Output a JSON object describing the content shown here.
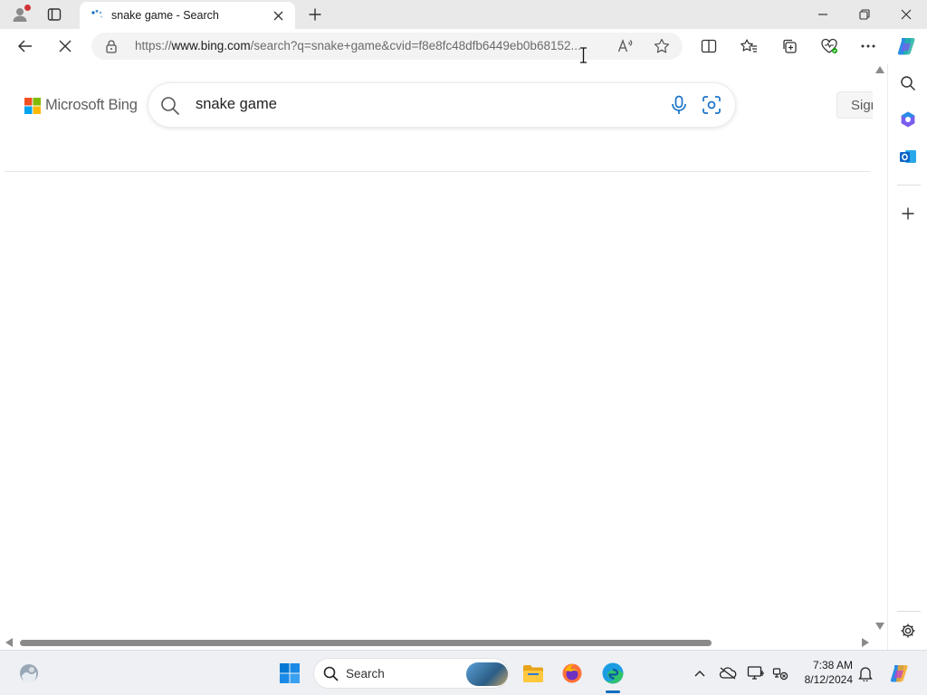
{
  "window": {
    "tab": {
      "title": "snake game - Search"
    }
  },
  "toolbar": {
    "address": {
      "prefix": "https://",
      "host": "www.bing.com",
      "path": "/search?q=snake+game&cvid=f8e8fc48dfb6449eb0b68152..."
    }
  },
  "page": {
    "logo_text": "Microsoft Bing",
    "search_value": "snake game",
    "signin_label": "Sign"
  },
  "taskbar": {
    "search_placeholder": "Search",
    "time": "7:38 AM",
    "date": "8/12/2024"
  },
  "colors": {
    "accent": "#0f6cbd",
    "ms_red": "#f25022",
    "ms_green": "#7fba00",
    "ms_blue": "#00a4ef",
    "ms_yellow": "#ffb900"
  },
  "icons": {
    "tab": [
      "profile-icon",
      "tab-actions-icon",
      "loading-spinner-icon",
      "close-icon",
      "plus-icon",
      "minimize-icon",
      "restore-icon",
      "close-window-icon"
    ],
    "toolbar": [
      "back-arrow-icon",
      "stop-loading-icon",
      "lock-icon",
      "read-aloud-icon",
      "favorite-star-icon",
      "split-screen-icon",
      "favorites-icon",
      "collections-icon",
      "browser-essentials-icon",
      "more-icon",
      "copilot-icon"
    ],
    "sidebar": [
      "search-icon",
      "copilot-apps-icon",
      "outlook-icon",
      "add-icon",
      "settings-icon"
    ],
    "taskbar": [
      "widgets-icon",
      "windows-start-icon",
      "file-explorer-icon",
      "firefox-icon",
      "edge-icon",
      "chevron-up-icon",
      "onedrive-icon",
      "display-icon",
      "network-icon",
      "bell-icon",
      "copilot-icon"
    ]
  }
}
